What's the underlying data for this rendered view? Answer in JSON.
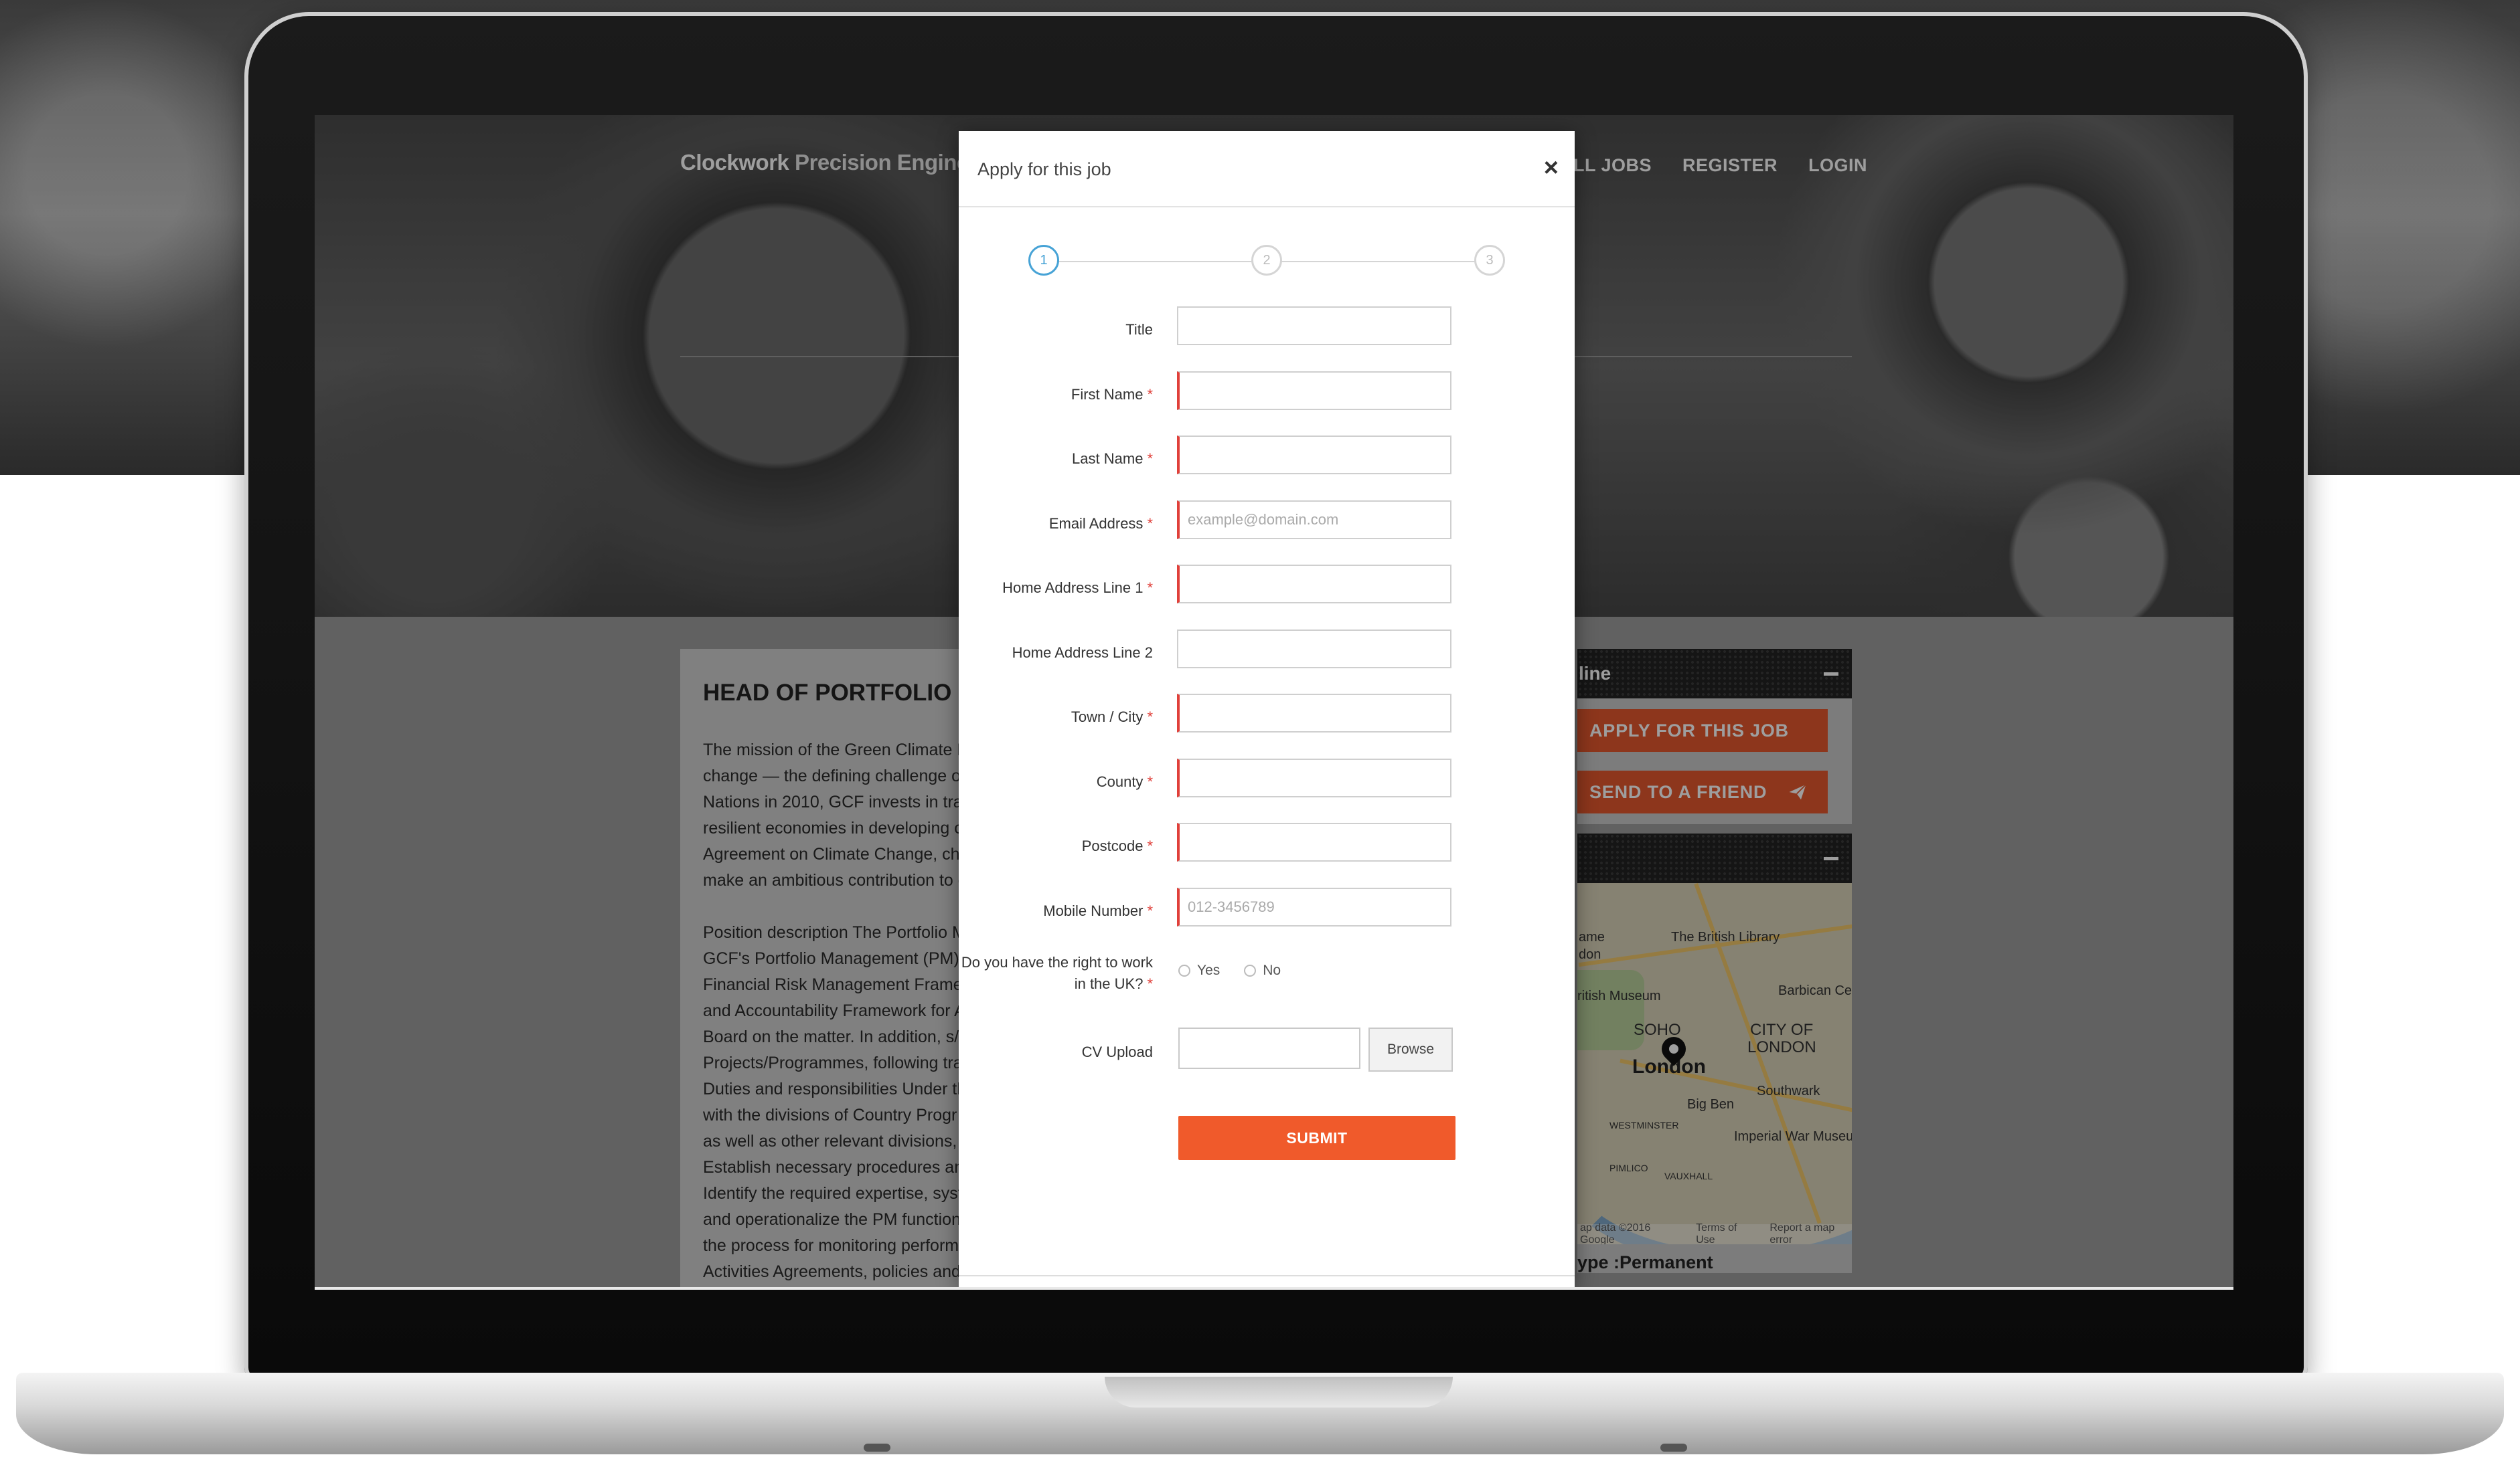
{
  "site": {
    "brand_bold": "Clockwork",
    "brand_light": " Precision Enginee",
    "nav": [
      "LL JOBS",
      "REGISTER",
      "LOGIN"
    ]
  },
  "job": {
    "title": "HEAD OF PORTFOLIO M",
    "text": "The mission of the Green Climate F\nchange — the defining challenge of\nNations in 2010, GCF invests in tran\nresilient economies in developing c\nAgreement on Climate Change, cha\nmake an ambitious contribution to g\n\nPosition description The Portfolio M\nGCF's Portfolio Management (PM) f\nFinancial Risk Management Framew\nand Accountability Framework for A\nBoard on the matter. In addition, s/h\nProjects/Programmes, following tra\nDuties and responsibilities Under th\nwith the divisions of Country Progr\nas well as other relevant divisions, t\nEstablish necessary procedures an\nIdentify the required expertise, syst\nand operationalize the PM functions\nthe process for monitoring perform\nActivities Agreements, policies and\nfurther the execution of Project"
  },
  "sidebar": {
    "panel1_title": "line",
    "apply_label": "APPLY FOR THIS JOB",
    "send_label": "SEND TO A FRIEND",
    "job_type": "ype :Permanent",
    "map": {
      "city": "London",
      "labels": [
        "The British Library",
        "ritish Museum",
        "Barbican Ce",
        "SOHO",
        "CITY OF",
        "LONDON",
        "Big Ben",
        "Southwark",
        "Imperial War Museu",
        "WESTMINSTER",
        "PIMLICO",
        "VAUXHALL",
        "ame",
        "don"
      ],
      "footer": [
        "ap data ©2016 Google",
        "Terms of Use",
        "Report a map error"
      ]
    }
  },
  "modal": {
    "title": "Apply for this job",
    "close": "×",
    "steps": [
      "1",
      "2",
      "3"
    ],
    "fields": [
      {
        "label": "Title",
        "required": false,
        "placeholder": ""
      },
      {
        "label": "First Name",
        "required": true,
        "placeholder": ""
      },
      {
        "label": "Last Name",
        "required": true,
        "placeholder": ""
      },
      {
        "label": "Email Address",
        "required": true,
        "placeholder": "example@domain.com"
      },
      {
        "label": "Home Address Line 1",
        "required": true,
        "placeholder": ""
      },
      {
        "label": "Home Address Line 2",
        "required": false,
        "placeholder": ""
      },
      {
        "label": "Town / City",
        "required": true,
        "placeholder": ""
      },
      {
        "label": "County",
        "required": true,
        "placeholder": ""
      },
      {
        "label": "Postcode",
        "required": true,
        "placeholder": ""
      },
      {
        "label": "Mobile Number",
        "required": true,
        "placeholder": "012-3456789"
      }
    ],
    "right_to_work": {
      "label": "Do you have the right to work in the UK?",
      "yes": "Yes",
      "no": "No"
    },
    "cv_label": "CV Upload",
    "browse_label": "Browse",
    "submit_label": "SUBMIT"
  },
  "colors": {
    "accent": "#f05a2b",
    "step_active": "#47a3d6",
    "required": "#e0403a"
  }
}
